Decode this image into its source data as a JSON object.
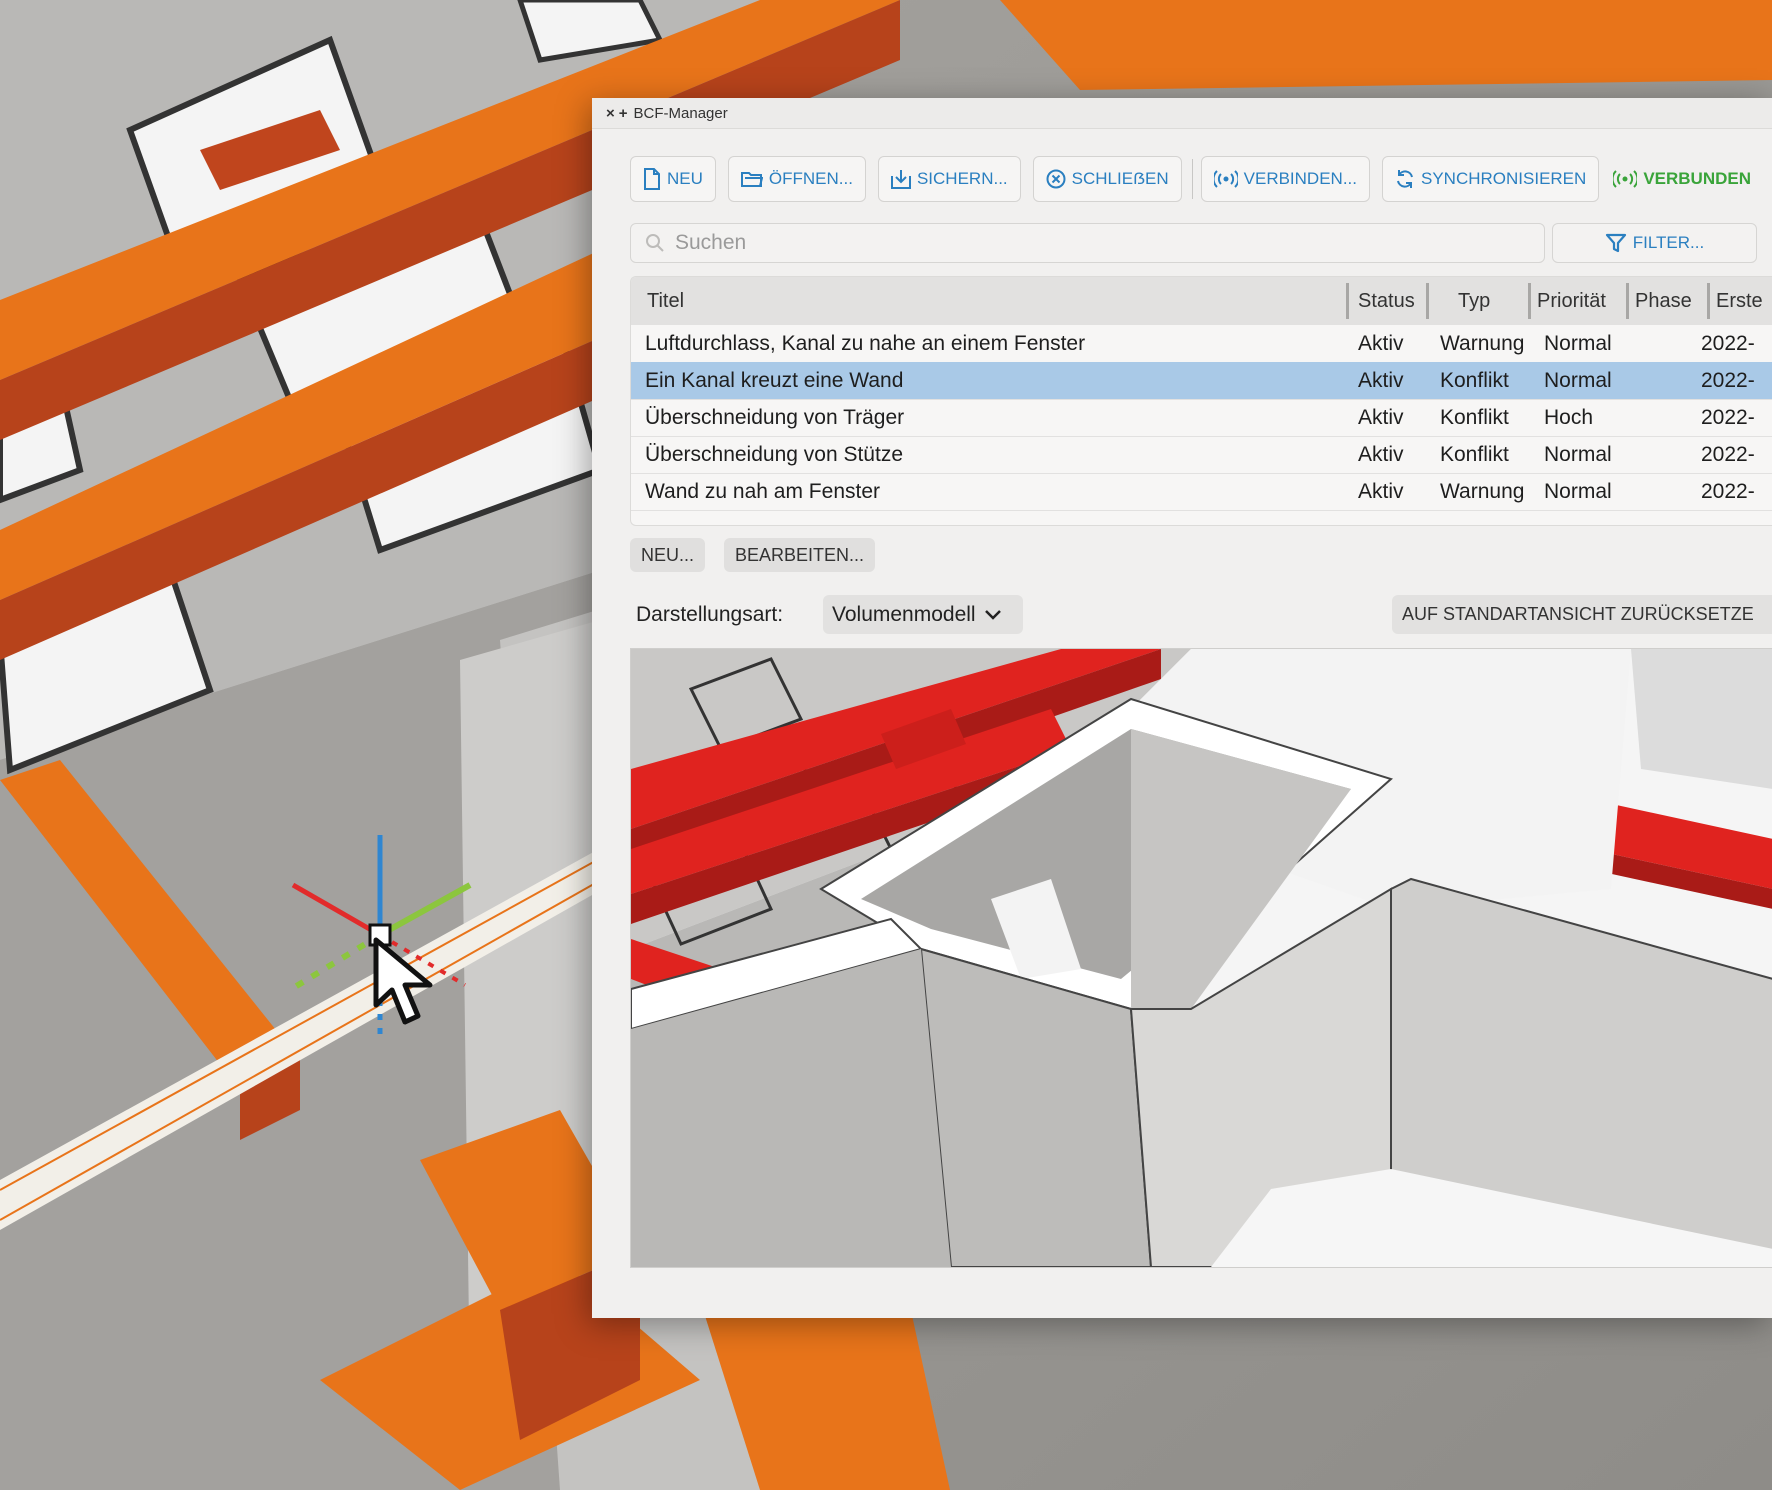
{
  "window": {
    "title": "BCF-Manager",
    "close_glyph": "×",
    "add_glyph": "+"
  },
  "toolbar": {
    "new_label": "NEU",
    "open_label": "ÖFFNEN...",
    "save_label": "SICHERN...",
    "close_label": "SCHLIEẞEN",
    "connect_label": "VERBINDEN...",
    "sync_label": "SYNCHRONISIEREN",
    "status_label": "VERBUNDEN"
  },
  "search": {
    "placeholder": "Suchen",
    "filter_label": "FILTER..."
  },
  "table": {
    "columns": [
      "Titel",
      "Status",
      "Typ",
      "Priorität",
      "Phase",
      "Erste"
    ],
    "rows": [
      {
        "title": "Luftdurchlass, Kanal zu nahe an einem Fenster",
        "status": "Aktiv",
        "type": "Warnung",
        "priority": "Normal",
        "phase": "",
        "created": "2022-"
      },
      {
        "title": "Ein Kanal kreuzt eine Wand",
        "status": "Aktiv",
        "type": "Konflikt",
        "priority": "Normal",
        "phase": "",
        "created": "2022-"
      },
      {
        "title": "Überschneidung von Träger",
        "status": "Aktiv",
        "type": "Konflikt",
        "priority": "Hoch",
        "phase": "",
        "created": "2022-"
      },
      {
        "title": "Überschneidung von Stütze",
        "status": "Aktiv",
        "type": "Konflikt",
        "priority": "Normal",
        "phase": "",
        "created": "2022-"
      },
      {
        "title": "Wand zu nah am Fenster",
        "status": "Aktiv",
        "type": "Warnung",
        "priority": "Normal",
        "phase": "",
        "created": "2022-"
      }
    ],
    "selected_index": 1
  },
  "row_actions": {
    "new_label": "NEU...",
    "edit_label": "BEARBEITEN..."
  },
  "display": {
    "label": "Darstellungsart:",
    "mode_value": "Volumenmodell",
    "reset_label": "AUF STANDARTANSICHT ZURÜCKSETZE"
  },
  "colors": {
    "accent": "#2a7fc0",
    "connected": "#3aa43a",
    "selection": "#a9c9e7",
    "duct_orange": "#e8741a",
    "duct_red": "#e0231f"
  },
  "icons": [
    "file-icon",
    "folder-open-icon",
    "save-download-icon",
    "close-circle-icon",
    "broadcast-icon",
    "sync-icon",
    "filter-icon",
    "search-icon",
    "chevron-down-icon",
    "mouse-pointer-icon"
  ]
}
